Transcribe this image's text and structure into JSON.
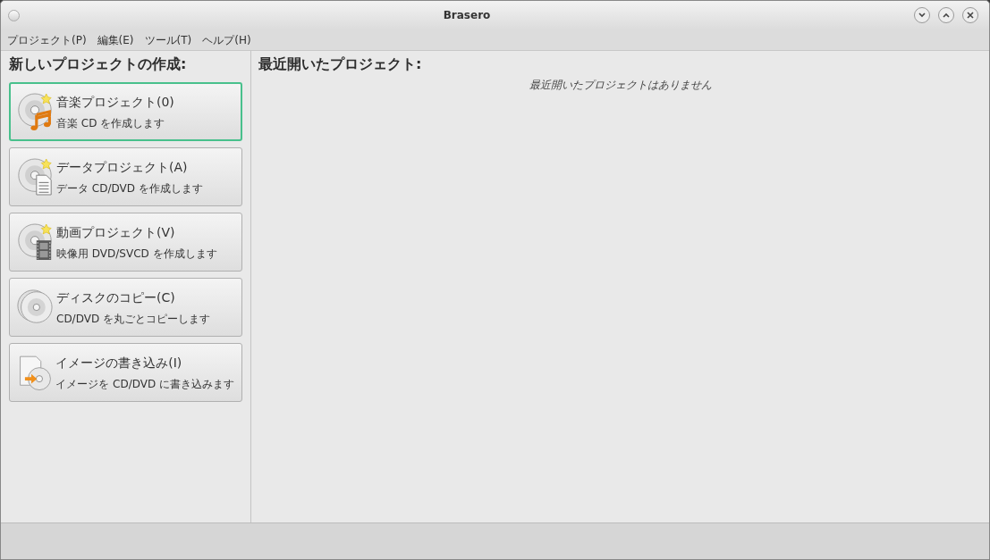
{
  "window": {
    "title": "Brasero"
  },
  "menu": [
    "プロジェクト(P)",
    "編集(E)",
    "ツール(T)",
    "ヘルプ(H)"
  ],
  "new_project": {
    "heading": "新しいプロジェクトの作成:",
    "buttons": [
      {
        "kind": "audio",
        "label": "音楽プロジェクト(0)",
        "description": "音楽 CD を作成します",
        "selected": true
      },
      {
        "kind": "data",
        "label": "データプロジェクト(A)",
        "description": "データ CD/DVD を作成します",
        "selected": false
      },
      {
        "kind": "video",
        "label": "動画プロジェクト(V)",
        "description": "映像用 DVD/SVCD を作成します",
        "selected": false
      },
      {
        "kind": "copy",
        "label": "ディスクのコピー(C)",
        "description": "CD/DVD を丸ごとコピーします",
        "selected": false
      },
      {
        "kind": "image",
        "label": "イメージの書き込み(I)",
        "description": "イメージを CD/DVD に書き込みます",
        "selected": false
      }
    ]
  },
  "recent": {
    "heading": "最近開いたプロジェクト:",
    "empty_message": "最近開いたプロジェクトはありません"
  }
}
